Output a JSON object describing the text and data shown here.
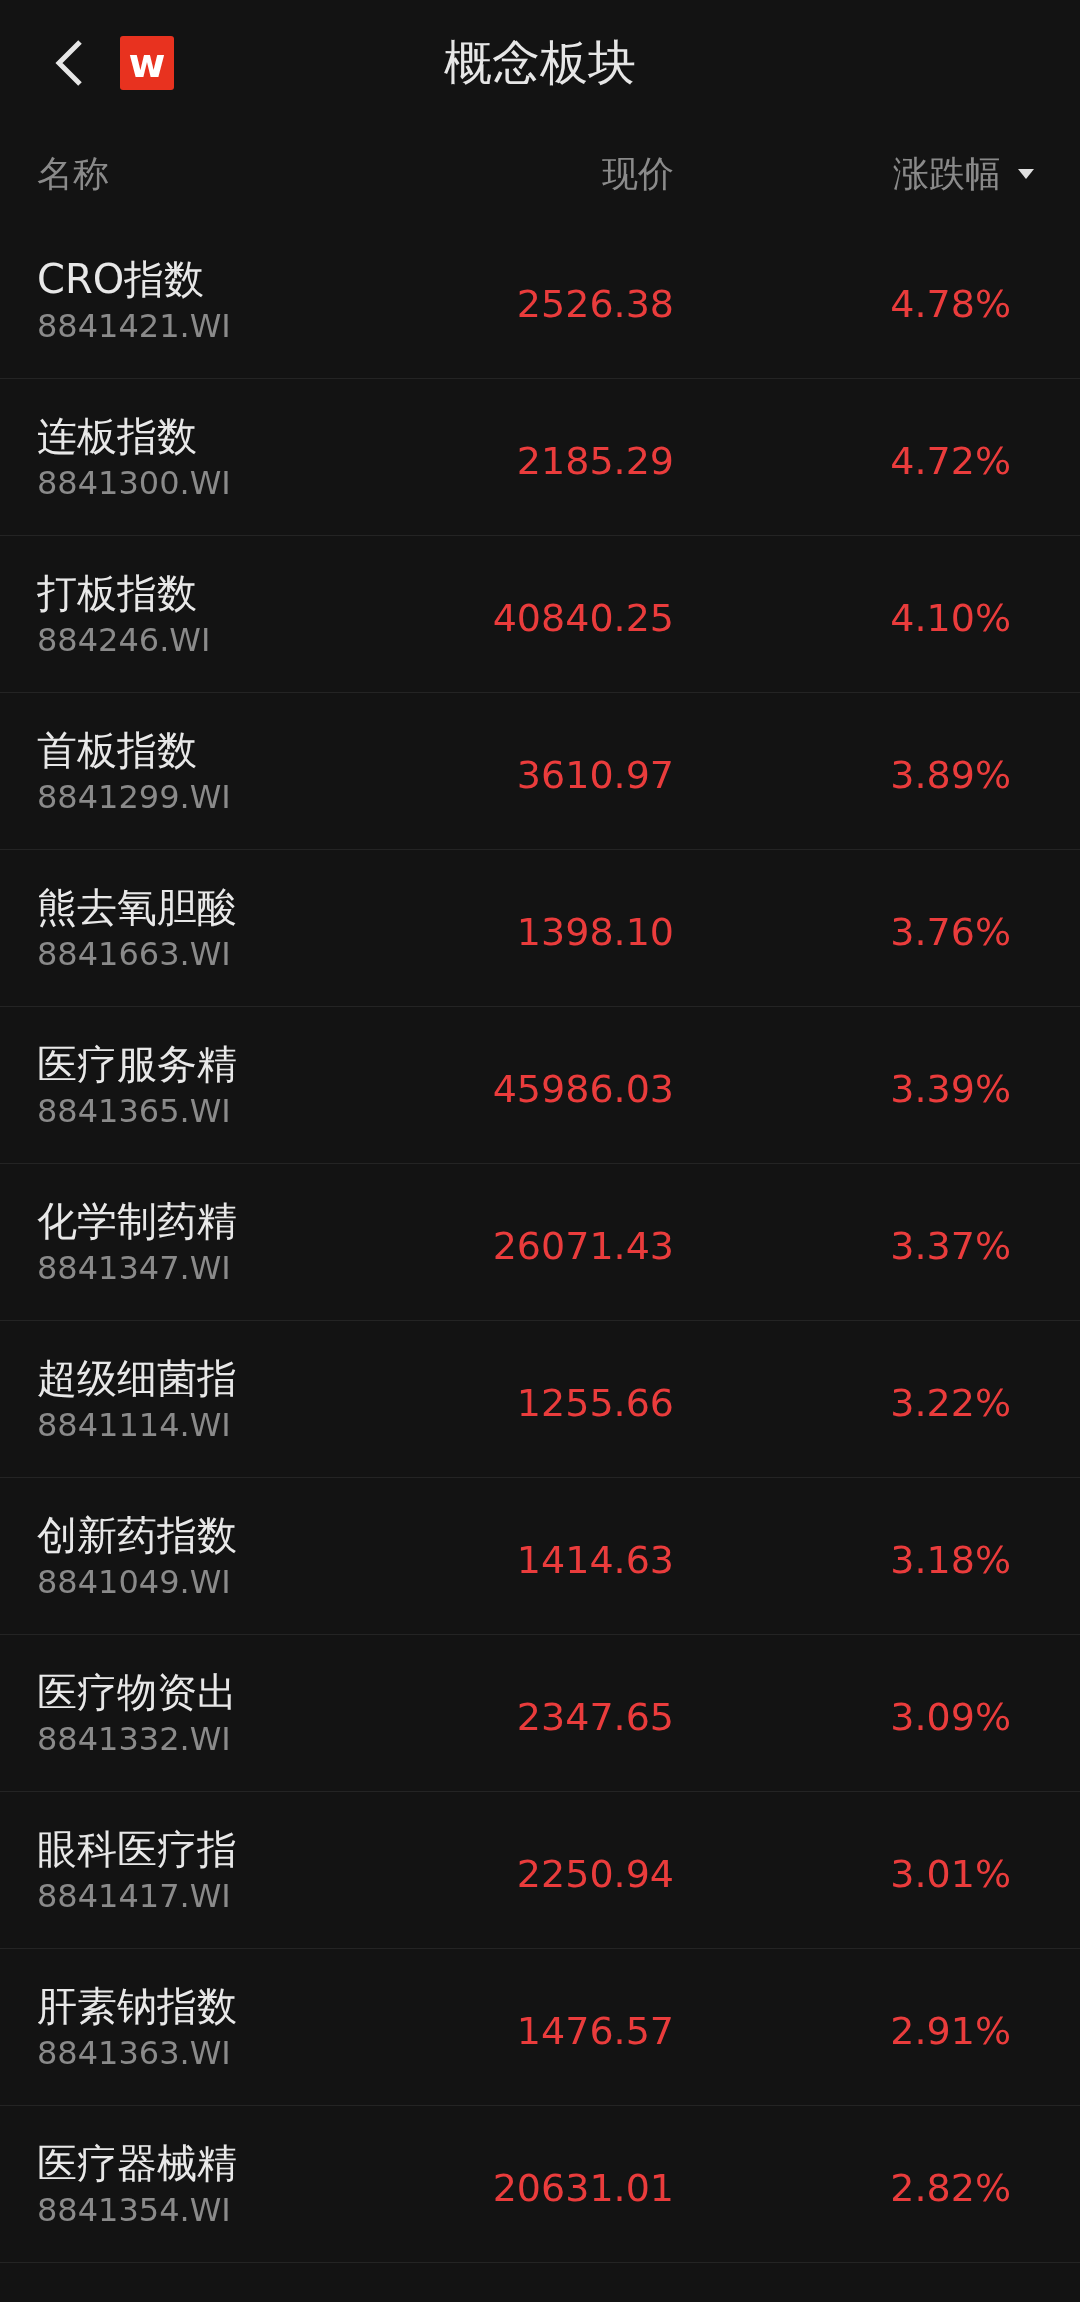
{
  "header": {
    "logo": "w",
    "title": "概念板块"
  },
  "columns": [
    "名称",
    "现价",
    "涨跌幅"
  ],
  "rows": [
    {
      "name": "CRO指数",
      "code": "8841421.WI",
      "price": "2526.38",
      "change": "4.78%"
    },
    {
      "name": "连板指数",
      "code": "8841300.WI",
      "price": "2185.29",
      "change": "4.72%"
    },
    {
      "name": "打板指数",
      "code": "884246.WI",
      "price": "40840.25",
      "change": "4.10%"
    },
    {
      "name": "首板指数",
      "code": "8841299.WI",
      "price": "3610.97",
      "change": "3.89%"
    },
    {
      "name": "熊去氧胆酸",
      "code": "8841663.WI",
      "price": "1398.10",
      "change": "3.76%"
    },
    {
      "name": "医疗服务精",
      "code": "8841365.WI",
      "price": "45986.03",
      "change": "3.39%"
    },
    {
      "name": "化学制药精",
      "code": "8841347.WI",
      "price": "26071.43",
      "change": "3.37%"
    },
    {
      "name": "超级细菌指",
      "code": "8841114.WI",
      "price": "1255.66",
      "change": "3.22%"
    },
    {
      "name": "创新药指数",
      "code": "8841049.WI",
      "price": "1414.63",
      "change": "3.18%"
    },
    {
      "name": "医疗物资出",
      "code": "8841332.WI",
      "price": "2347.65",
      "change": "3.09%"
    },
    {
      "name": "眼科医疗指",
      "code": "8841417.WI",
      "price": "2250.94",
      "change": "3.01%"
    },
    {
      "name": "肝素钠指数",
      "code": "8841363.WI",
      "price": "1476.57",
      "change": "2.91%"
    },
    {
      "name": "医疗器械精",
      "code": "8841354.WI",
      "price": "20631.01",
      "change": "2.82%"
    }
  ]
}
